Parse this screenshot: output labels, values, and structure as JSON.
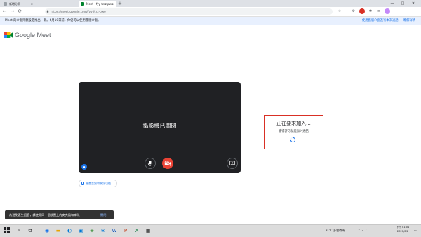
{
  "browser": {
    "tabs": [
      {
        "title": "新增分頁",
        "active": false
      },
      {
        "title": "Meet - fyy-fcrz-pwe",
        "active": true
      }
    ],
    "new_tab_glyph": "+",
    "window_controls": [
      "—",
      "□",
      "✕"
    ],
    "nav": {
      "back": "←",
      "forward": "→",
      "reload": "⟳"
    },
    "url": "https://meet.google.com/fyy-fcrz-pwe"
  },
  "infobar": {
    "message": "Meet 的介面外觀設定推出一新。6月10日前，你仍可以使用舊版介面。",
    "link_switch": "使用舊版介面進行本次通話",
    "link_more": "瞭解詳情"
  },
  "app": {
    "logo_text": "Google Meet"
  },
  "preview": {
    "camera_off_text": "攝影機已關閉",
    "check_button_label": "檢查音訊和視訊功能"
  },
  "join_panel": {
    "title": "正在要求加入...",
    "subtitle": "獲得許可就能加入通話"
  },
  "snackbar": {
    "message": "為避免產生回音，請使用同一個裝置上的麥克風和喇叭",
    "action": "關閉"
  },
  "taskbar": {
    "weather": "31°C 多雲時晴",
    "time": "下午 01:01",
    "date": "2021/6/8"
  },
  "colors": {
    "accent": "#1a73e8",
    "camera_off_red": "#ea4335",
    "highlight_box": "#d93025"
  }
}
